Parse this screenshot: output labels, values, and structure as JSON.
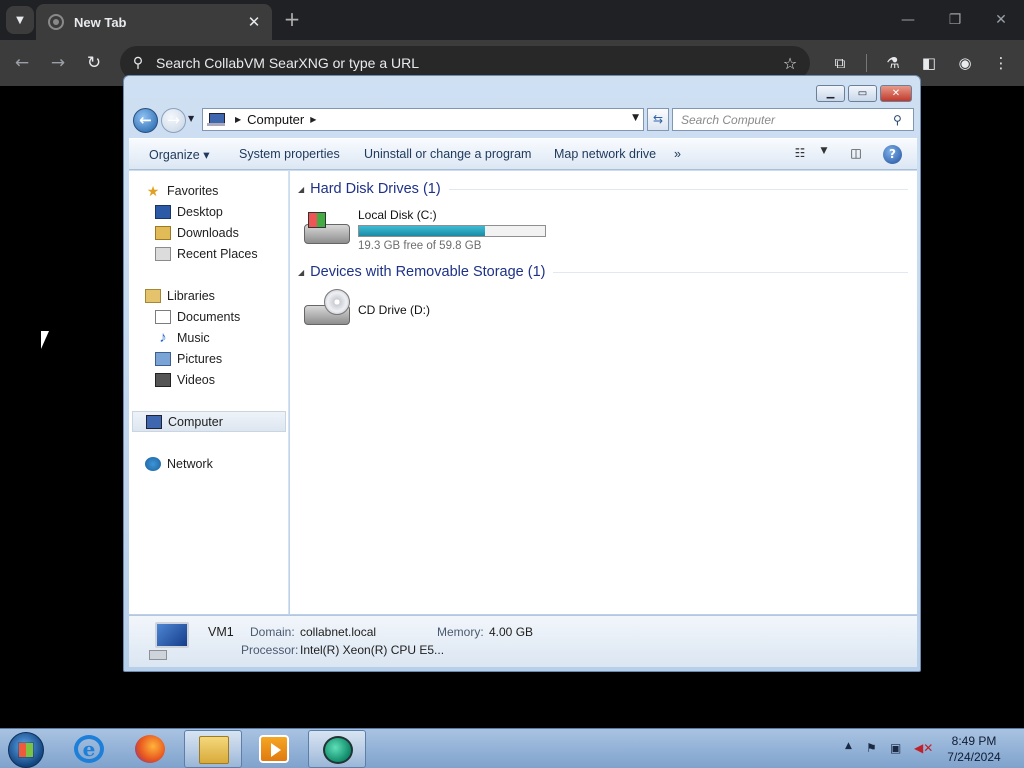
{
  "browser": {
    "tab_title": "New Tab",
    "tab_close": "✕",
    "new_tab": "+",
    "omnibox_text": "Search CollabVM SearXNG or type a URL",
    "window_minimize": "—",
    "window_restore": "❐",
    "window_close": "✕"
  },
  "explorer": {
    "address_crumb": "Computer",
    "search_placeholder": "Search Computer",
    "commands": {
      "organize": "Organize ▾",
      "system_properties": "System properties",
      "uninstall": "Uninstall or change a program",
      "map_drive": "Map network drive",
      "more": "»"
    },
    "nav": {
      "favorites": "Favorites",
      "desktop": "Desktop",
      "downloads": "Downloads",
      "recent_places": "Recent Places",
      "libraries": "Libraries",
      "documents": "Documents",
      "music": "Music",
      "pictures": "Pictures",
      "videos": "Videos",
      "computer": "Computer",
      "network": "Network"
    },
    "groups": {
      "hard_disk": "Hard Disk Drives (1)",
      "removable": "Devices with Removable Storage (1)"
    },
    "drives": {
      "c_name": "Local Disk (C:)",
      "c_free_text": "19.3 GB free of 59.8 GB",
      "c_used_percent": 68,
      "d_name": "CD Drive (D:)"
    },
    "details": {
      "name": "VM1",
      "domain_label": "Domain:",
      "domain_value": "collabnet.local",
      "memory_label": "Memory:",
      "memory_value": "4.00 GB",
      "processor_label": "Processor:",
      "processor_value": "Intel(R) Xeon(R) CPU E5..."
    }
  },
  "taskbar": {
    "time": "8:49 PM",
    "date": "7/24/2024"
  },
  "colors": {
    "chrome_dark": "#202124",
    "explorer_frame": "#b8cfea",
    "group_title": "#1e3287",
    "drive_bar": "#1b8aa5"
  }
}
